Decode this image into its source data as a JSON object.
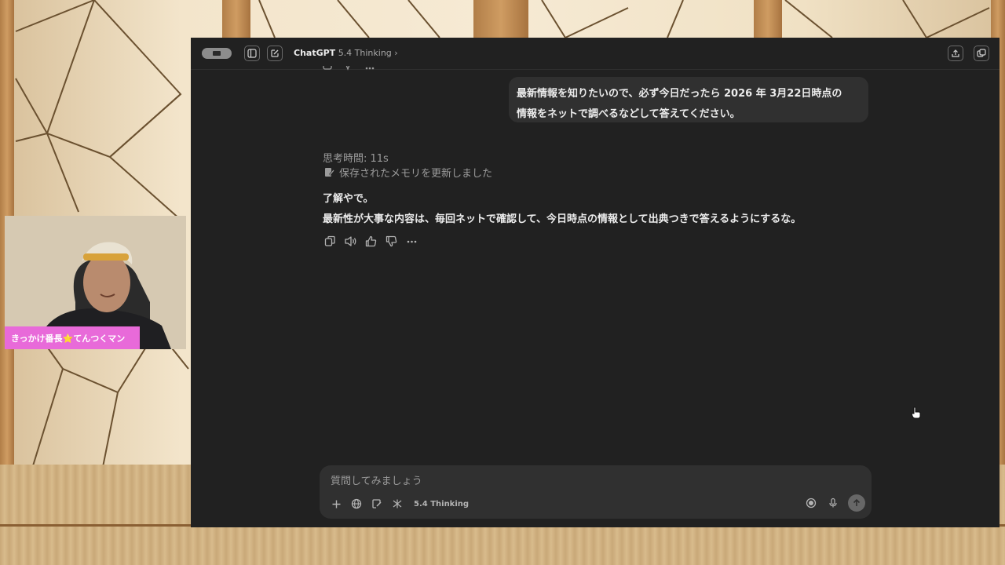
{
  "window": {
    "app_name": "ChatGPT",
    "model_label": "5.4 Thinking",
    "chevron": "›"
  },
  "conversation": {
    "user_message_line1": "最新情報を知りたいので、必ず今日だったら 2026 年 3月22日時点の",
    "user_message_line2": "情報をネットで調べるなどして答えてください。",
    "thinking_time": "思考時間: 11s",
    "memory_notice": "保存されたメモリを更新しました",
    "reply_line1": "了解やで。",
    "reply_line2": "最新性が大事な内容は、毎回ネットで確認して、今日時点の情報として出典つきで答えるようにするな。",
    "action_icons": [
      "copy-icon",
      "speaker-icon",
      "thumbs-up-icon",
      "thumbs-down-icon",
      "more-icon"
    ]
  },
  "composer": {
    "placeholder": "質問してみましょう",
    "model_chip": "5.4 Thinking",
    "tool_icons": [
      "plus-icon",
      "globe-icon",
      "canvas-icon",
      "apps-icon"
    ]
  },
  "overlay": {
    "streamer_name": "きっかけ番長⭐てんつくマン"
  },
  "colors": {
    "window_bg": "#212121",
    "bubble_bg": "#303030",
    "name_tag_bg": "#e86ad9"
  }
}
